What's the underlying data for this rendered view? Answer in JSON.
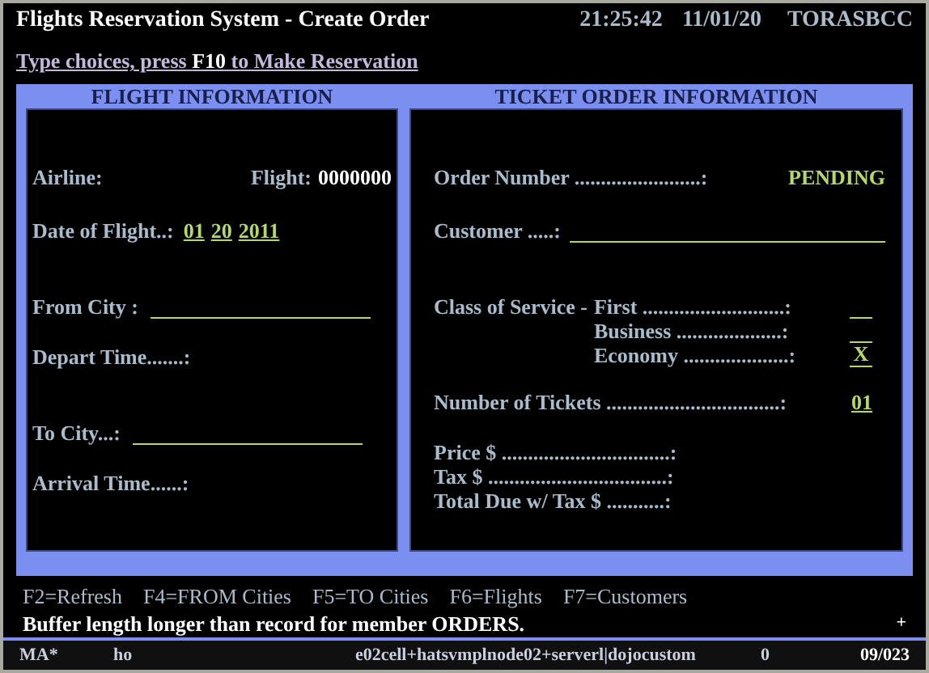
{
  "header": {
    "title": "Flights Reservation System - Create Order",
    "time": "21:25:42",
    "date": "11/01/20",
    "system": "TORASBCC"
  },
  "instruction": "Type choices, press **F10** to Make Reservation",
  "flight_info": {
    "heading": "FLIGHT INFORMATION",
    "airline_label": "Airline:",
    "flight_label": "Flight:",
    "flight_value": "0000000",
    "date_label": "Date of Flight..:",
    "date_parts": [
      "01",
      "20",
      "2011"
    ],
    "from_label": "From City :",
    "depart_label": "Depart Time.......:",
    "to_label": "To City...:",
    "arrival_label": "Arrival Time......:"
  },
  "ticket_info": {
    "heading": "TICKET ORDER INFORMATION",
    "order_label": "Order Number ........................:",
    "order_value": "PENDING",
    "customer_label": "Customer .....:",
    "class_label": "Class of Service -",
    "classes": [
      {
        "label": "First ...........................:"
      },
      {
        "label": "Business ....................:"
      },
      {
        "label": "Economy ....................:",
        "value": "X"
      }
    ],
    "tickets_label": "Number of Tickets .................................:",
    "tickets_value": "01",
    "price_lines": [
      "Price  $ ................................:",
      "Tax  $ ..................................:",
      "Total Due w/ Tax  $ ...........:"
    ]
  },
  "function_keys": [
    "F2=Refresh",
    "F4=FROM Cities",
    "F5=TO Cities",
    "F6=Flights",
    "F7=Customers"
  ],
  "message": "Buffer length longer than record for member ORDERS.",
  "message_mark": "+",
  "status_bar": {
    "mode": "MA*",
    "user": "ho",
    "server": "e02cell+hatsvmplnode02+serverl|dojocustom",
    "count": "0",
    "position": "09/023"
  }
}
